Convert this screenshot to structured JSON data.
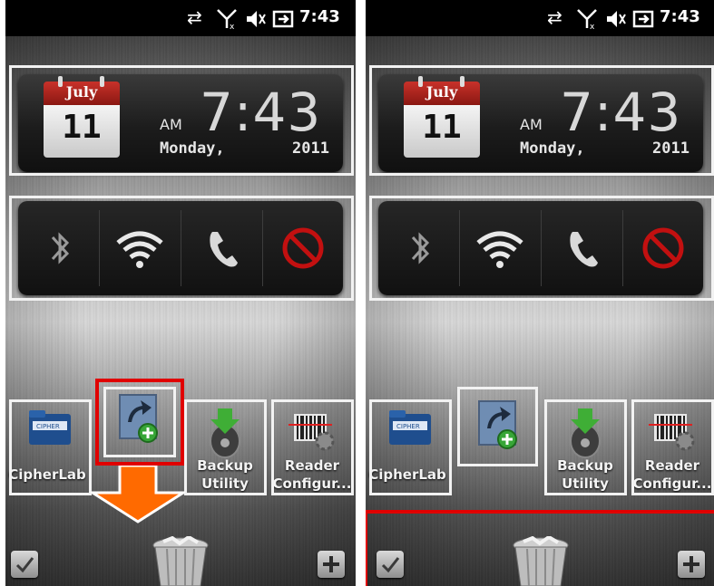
{
  "status_bar": {
    "time": "7:43",
    "icons": [
      "sync-icon",
      "signal-off-icon",
      "speaker-muted-icon",
      "battery-charging-icon"
    ]
  },
  "clock": {
    "month": "July",
    "day": "11",
    "ampm": "AM",
    "time": "7:43",
    "weekday": "Monday,",
    "year": "2011"
  },
  "toggles": [
    "bluetooth-icon",
    "wifi-icon",
    "phone-icon",
    "disabled-icon"
  ],
  "apps": [
    {
      "label": "CipherLab",
      "icon": "cipherlab-folder-icon"
    },
    {
      "label": "",
      "icon": "shortcut-add-icon"
    },
    {
      "label_line1": "Backup",
      "label_line2": "Utility",
      "icon": "backup-utility-icon"
    },
    {
      "label_line1": "Reader",
      "label_line2": "Configur...",
      "icon": "reader-config-icon"
    }
  ],
  "colors": {
    "highlight_red": "#e00000",
    "drag_arrow": "#ff6a00",
    "frame_white": "#f2f2f2"
  }
}
